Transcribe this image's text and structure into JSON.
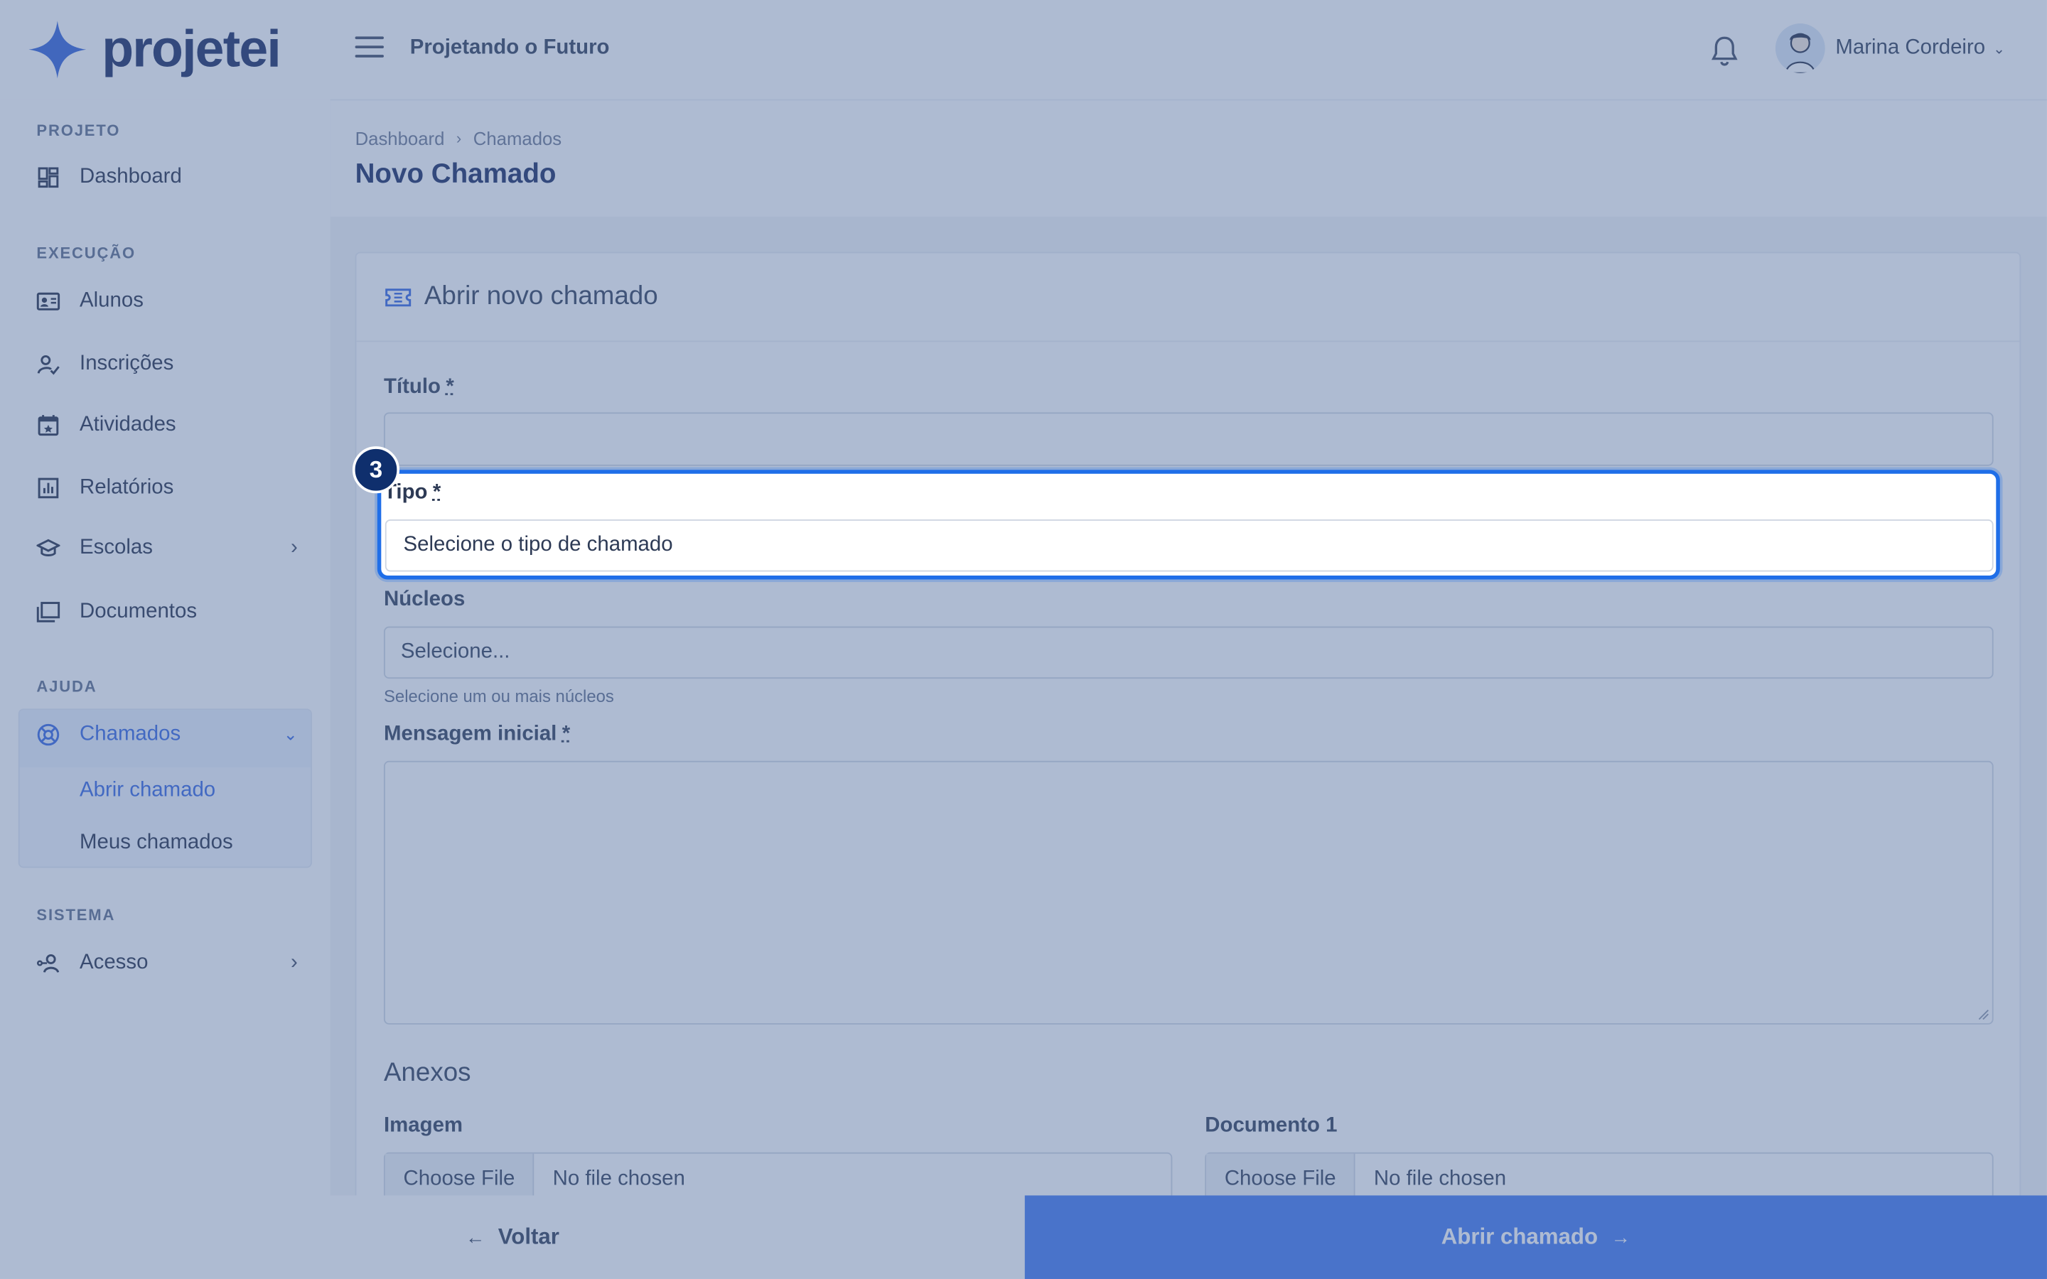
{
  "app": {
    "logo_text": "projetei",
    "project_name": "Projetando o Futuro",
    "user_name": "Marina Cordeiro"
  },
  "sidebar": {
    "sections": {
      "projeto": "PROJETO",
      "execucao": "EXECUÇÃO",
      "ajuda": "AJUDA",
      "sistema": "SISTEMA"
    },
    "items": {
      "dashboard": "Dashboard",
      "alunos": "Alunos",
      "inscricoes": "Inscrições",
      "atividades": "Atividades",
      "relatorios": "Relatórios",
      "escolas": "Escolas",
      "documentos": "Documentos",
      "chamados": "Chamados",
      "abrir_chamado": "Abrir chamado",
      "meus_chamados": "Meus chamados",
      "acesso": "Acesso"
    }
  },
  "breadcrumb": [
    "Dashboard",
    "Chamados"
  ],
  "page_title": "Novo Chamado",
  "form": {
    "card_title": "Abrir novo chamado",
    "titulo_label": "Título",
    "required_mark": "*",
    "tipo_label": "Tipo",
    "tipo_placeholder": "Selecione o tipo de chamado",
    "nucleos_label": "Núcleos",
    "nucleos_placeholder": "Selecione...",
    "nucleos_help": "Selecione um ou mais núcleos",
    "mensagem_label": "Mensagem inicial",
    "anexos_title": "Anexos",
    "imagem_label": "Imagem",
    "documento_label": "Documento 1",
    "choose_file": "Choose File",
    "no_file": "No file chosen"
  },
  "footer": {
    "back_label": "Voltar",
    "submit_label": "Abrir chamado"
  },
  "tour": {
    "step_number": "3"
  },
  "colors": {
    "accent": "#3f76f0",
    "brand_dark": "#14265c",
    "highlight_border": "#1f6ee8"
  }
}
